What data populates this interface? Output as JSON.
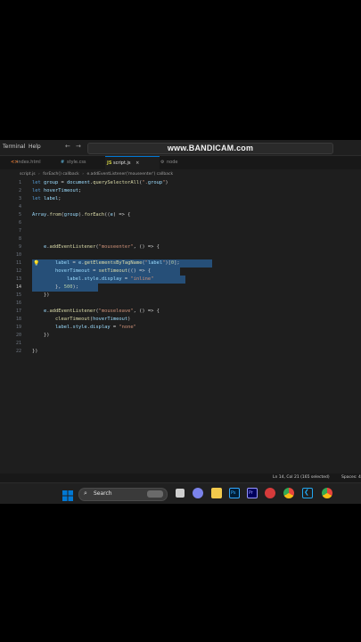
{
  "titlebar": {
    "menu": [
      "Terminal",
      "Help"
    ],
    "back_arrow": "←",
    "forward_arrow": "→",
    "watermark": "www.BANDICAM.com"
  },
  "tabs": [
    {
      "label": "index.html",
      "icon": "html-file-icon",
      "icon_glyph": "<>",
      "icon_color": "#e37933",
      "active": false
    },
    {
      "label": "style.css",
      "icon": "css-file-icon",
      "icon_glyph": "#",
      "icon_color": "#519aba",
      "active": false
    },
    {
      "label": "script.js",
      "icon": "js-file-icon",
      "icon_glyph": "JS",
      "icon_color": "#cbcb41",
      "active": true,
      "close": "×"
    },
    {
      "label": "node",
      "icon": "settings-file-icon",
      "icon_glyph": "⚙",
      "icon_color": "#8b8b8b",
      "active": false
    }
  ],
  "breadcrumb": [
    "script.js",
    "forEach() callback",
    "e.addEventListener('mouseenter') callback"
  ],
  "editor": {
    "current_line": "14",
    "lines": [
      {
        "n": "1",
        "text": "let group = document.querySelectorAll(\".group\")"
      },
      {
        "n": "2",
        "text": "let hoverTimeout;"
      },
      {
        "n": "3",
        "text": "let label;"
      },
      {
        "n": "4",
        "text": ""
      },
      {
        "n": "5",
        "text": "Array.from(group).forEach((e) => {"
      },
      {
        "n": "6",
        "text": ""
      },
      {
        "n": "7",
        "text": ""
      },
      {
        "n": "8",
        "text": ""
      },
      {
        "n": "9",
        "text": "    e.addEventListener(\"mouseenter\", () => {"
      },
      {
        "n": "10",
        "text": ""
      },
      {
        "n": "11",
        "text": "        label = e.getElementsByTagName(\"label\")[0];"
      },
      {
        "n": "12",
        "text": "        hoverTimeout = setTimeout(() => {"
      },
      {
        "n": "13",
        "text": "            label.style.display = \"inline\""
      },
      {
        "n": "14",
        "text": "        }, 500);"
      },
      {
        "n": "15",
        "text": "    })"
      },
      {
        "n": "16",
        "text": ""
      },
      {
        "n": "17",
        "text": "    e.addEventListener(\"mouseleave\", () => {"
      },
      {
        "n": "18",
        "text": "        clearTimeout(hoverTimeout)"
      },
      {
        "n": "19",
        "text": "        label.style.display = \"none\""
      },
      {
        "n": "20",
        "text": "    })"
      },
      {
        "n": "21",
        "text": ""
      },
      {
        "n": "22",
        "text": "})"
      }
    ]
  },
  "statusbar": {
    "position": "Ln 14, Col 21 (165 selected)",
    "spaces": "Spaces: 4"
  },
  "taskbar": {
    "search_label": "Search",
    "icons": [
      {
        "name": "windows-start-icon",
        "color": "#0078d4"
      },
      {
        "name": "task-view-icon",
        "color": "#d0d0d0"
      },
      {
        "name": "chat-icon",
        "color": "#7b83eb"
      },
      {
        "name": "file-explorer-icon",
        "color": "#f2c94c"
      },
      {
        "name": "photoshop-icon",
        "color": "#31a8ff"
      },
      {
        "name": "premiere-icon",
        "color": "#9999ff"
      },
      {
        "name": "record-icon",
        "color": "#d63b3b"
      },
      {
        "name": "chrome-icon",
        "color": "#e8453c"
      },
      {
        "name": "vscode-icon",
        "color": "#22a7f0"
      },
      {
        "name": "chrome-icon-2",
        "color": "#34a853"
      }
    ]
  }
}
